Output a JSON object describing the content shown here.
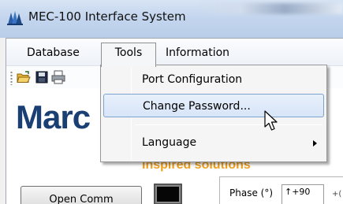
{
  "window": {
    "title": "MEC-100 Interface System",
    "app_icon": "app-logo-icon"
  },
  "menubar": {
    "items": [
      {
        "label": "Database"
      },
      {
        "label": "Tools"
      },
      {
        "label": "Information"
      }
    ]
  },
  "toolbar": {
    "icons": [
      "open-folder-icon",
      "save-disk-icon",
      "print-icon"
    ]
  },
  "brand": {
    "text": "Marc",
    "tagline": "Inspired solutions",
    "colors": {
      "brand_blue": "#1a3f73",
      "tagline_orange": "#f0a01c"
    }
  },
  "tools_menu": {
    "items": [
      {
        "label": "Port Configuration"
      },
      {
        "label": "Change Password..."
      },
      {
        "label": "Language"
      }
    ],
    "highlighted": "Change Password...",
    "highlight_color": "#d7e5f8"
  },
  "controls": {
    "open_comm_label": "Open Comm",
    "phase_label": "Phase (°)",
    "phase_value": "↑+90",
    "phase_partial": "+("
  }
}
